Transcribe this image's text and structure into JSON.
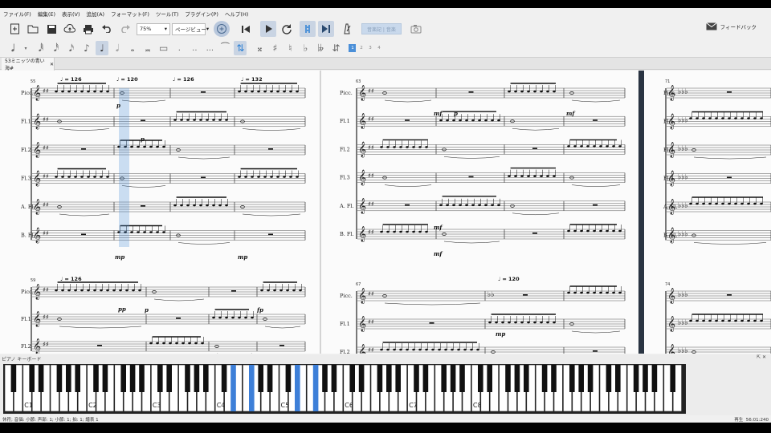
{
  "menu": [
    "ファイル(F)",
    "編集(E)",
    "表示(V)",
    "追加(A)",
    "フォーマット(F)",
    "ツール(T)",
    "プラグイン(P)",
    "ヘルプ(H)"
  ],
  "toolbar": {
    "zoom_value": "75%",
    "view_mode": "ページビュー",
    "disabled_button": "音楽記 | 音楽",
    "feedback": "フィードバック"
  },
  "note_input": {
    "voices": [
      "1",
      "2",
      "3",
      "4"
    ],
    "active_voice": "1"
  },
  "tab": {
    "title": "53ミニッツの青い海#"
  },
  "score": {
    "systems": [
      {
        "measure": "55",
        "tempos": [
          "♩ = 126",
          "♩ = 120",
          "♩ = 126",
          "♩ = 132"
        ]
      },
      {
        "measure": "63"
      },
      {
        "measure": "71"
      },
      {
        "measure": "59",
        "tempos": [
          "♩ = 126"
        ]
      },
      {
        "measure": "67",
        "tempos": [
          "♩ = 120"
        ]
      },
      {
        "measure": "74"
      }
    ],
    "instruments": [
      "Picc.",
      "Fl.1",
      "Fl.2",
      "Fl.3",
      "A. Fl.",
      "B. Fl."
    ],
    "dynamics": [
      "mp",
      "p",
      "mf",
      "pp",
      "fp"
    ]
  },
  "keyboard": {
    "title": "ピアノ キーボード",
    "controls": "⇱ ✕",
    "octave_labels": [
      "C1",
      "C2",
      "C3",
      "C4",
      "C5",
      "C6",
      "C7",
      "C8"
    ],
    "highlighted_keys": [
      "D#4",
      "F#4",
      "D#5",
      "F#5"
    ]
  },
  "status": {
    "left": "休符; 音価: 小節: 声部: 1; 小節: 1; 拍: 1; 譜表 1",
    "right_label": "再生",
    "right_time": "56:01:240"
  }
}
